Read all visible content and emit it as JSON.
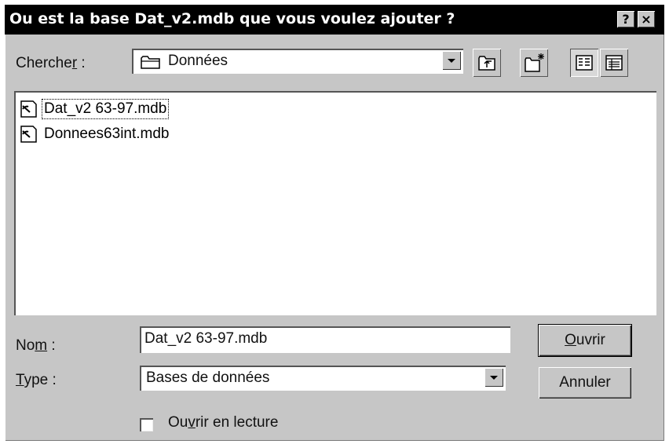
{
  "dialog": {
    "title": "Ou est la base Dat_v2.mdb que vous voulez ajouter ?",
    "help_button": "?",
    "close_button": "×"
  },
  "lookin": {
    "label_pre": "Cherche",
    "label_accel": "r",
    "label_post": " :",
    "value": "Données"
  },
  "files": [
    {
      "name": "Dat_v2 63-97.mdb",
      "selected": true
    },
    {
      "name": "Donnees63int.mdb",
      "selected": false
    }
  ],
  "filename": {
    "label_pre": "No",
    "label_accel": "m",
    "label_post": " :",
    "value": "Dat_v2 63-97.mdb"
  },
  "filetype": {
    "label_accel": "T",
    "label_post": "ype :",
    "value": "Bases de données"
  },
  "buttons": {
    "open_accel": "O",
    "open_rest": "uvrir",
    "cancel": "Annuler"
  },
  "readonly": {
    "pre": "Ou",
    "accel": "v",
    "post": "rir en lecture",
    "checked": false
  },
  "icons": {
    "folder": "folder-icon",
    "up": "up-folder-icon",
    "new_folder": "new-folder-icon",
    "list_view": "list-view-icon",
    "details_view": "details-view-icon",
    "database_file": "database-file-icon"
  }
}
